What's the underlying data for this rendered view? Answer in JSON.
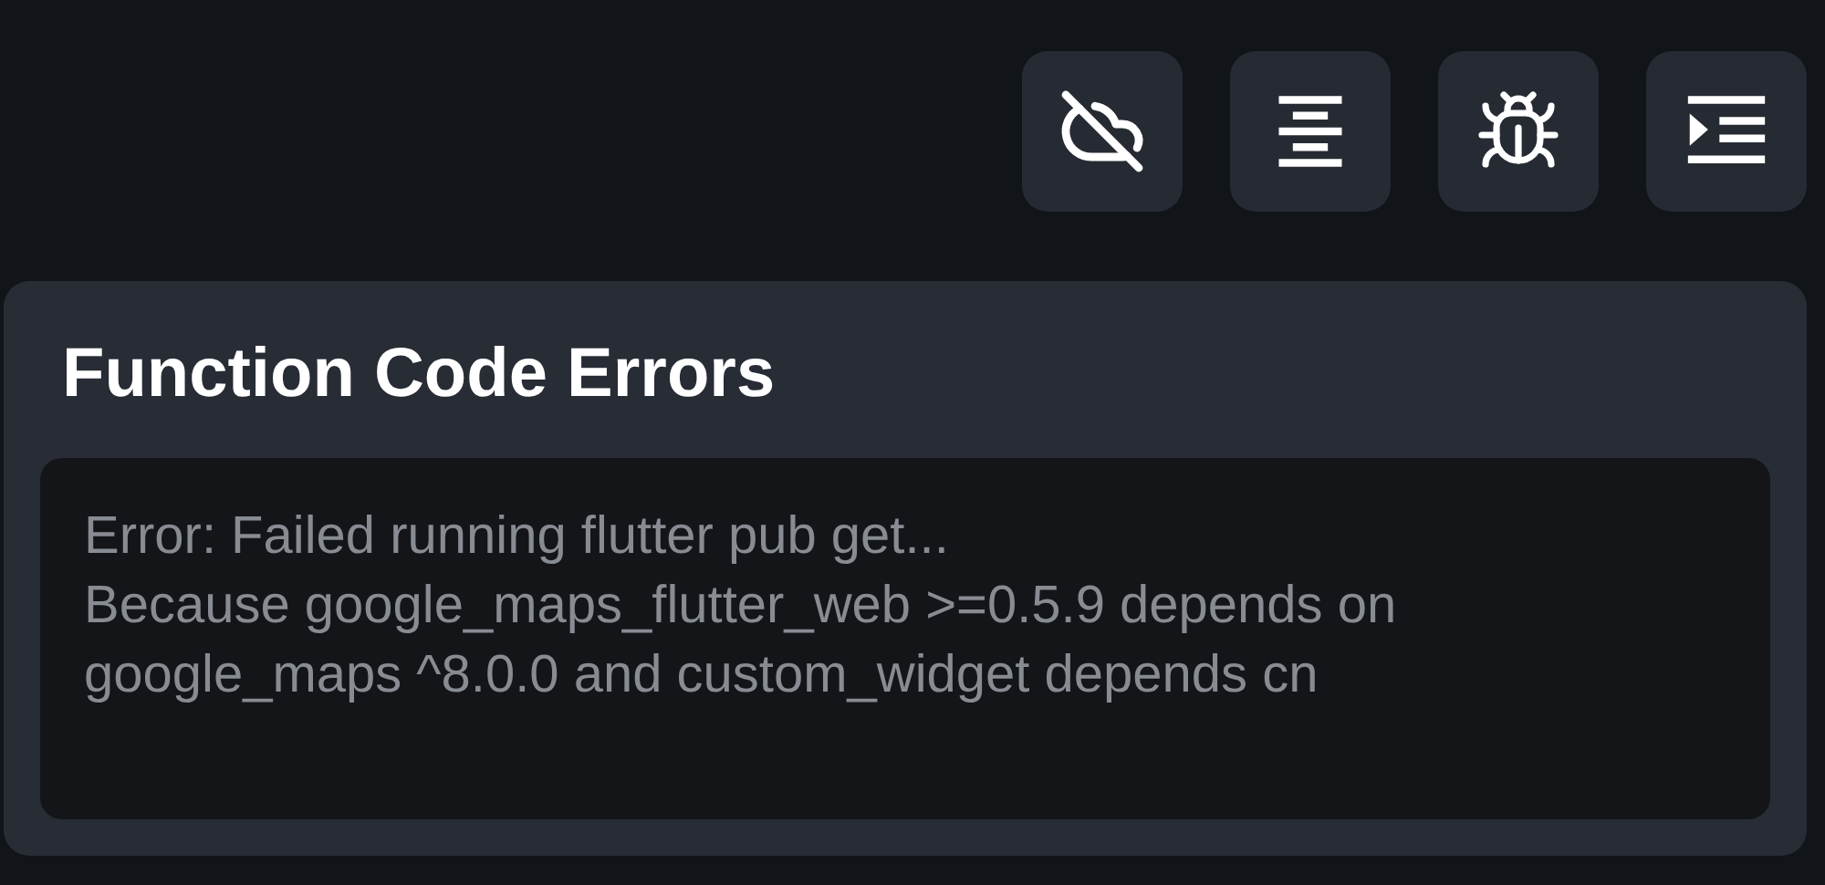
{
  "panel": {
    "title": "Function Code Errors",
    "error_lines": [
      "Error: Failed running flutter pub get...",
      "Because google_maps_flutter_web >=0.5.9 depends on",
      "google_maps ^8.0.0 and custom_widget depends cn"
    ]
  }
}
